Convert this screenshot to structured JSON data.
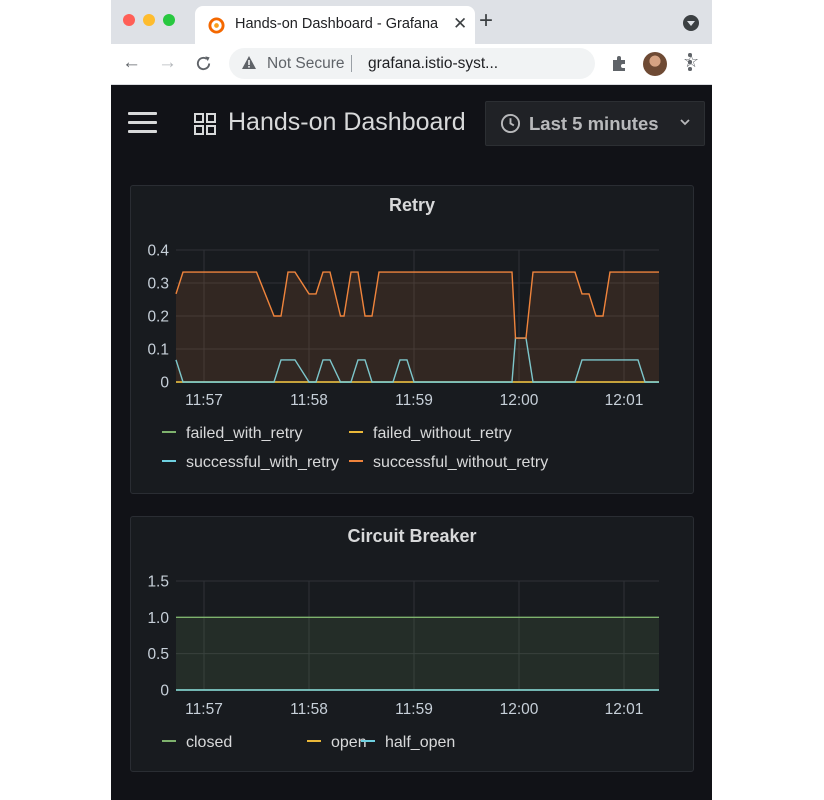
{
  "browser": {
    "tab_title": "Hands-on Dashboard - Grafana",
    "new_tab": "+",
    "close": "✕",
    "security_label": "Not Secure",
    "url": "grafana.istio-syst..."
  },
  "dashboard": {
    "title": "Hands-on Dashboard",
    "time_range": "Last 5 minutes"
  },
  "colors": {
    "failed_with_retry": "#7eb26d",
    "failed_without_retry": "#eab839",
    "successful_with_retry": "#6ed0e0",
    "successful_without_retry": "#ef843c",
    "closed": "#7eb26d",
    "open": "#eab839",
    "half_open": "#6ed0e0"
  },
  "panels": [
    {
      "title": "Retry",
      "chart_data": {
        "type": "line",
        "x": [
          "11:56:44",
          "11:56:48",
          "11:56:52",
          "11:57:00",
          "11:57:10",
          "11:57:20",
          "11:57:30",
          "11:57:40",
          "11:57:44",
          "11:57:48",
          "11:57:52",
          "11:58:00",
          "11:58:04",
          "11:58:08",
          "11:58:12",
          "11:58:18",
          "11:58:20",
          "11:58:24",
          "11:58:28",
          "11:58:32",
          "11:58:36",
          "11:58:40",
          "11:58:44",
          "11:58:48",
          "11:58:52",
          "11:58:56",
          "11:59:00",
          "11:59:04",
          "11:59:08",
          "11:59:12",
          "11:59:16",
          "11:59:20",
          "11:59:30",
          "11:59:40",
          "11:59:48",
          "11:59:56",
          "11:59:58",
          "12:00:04",
          "12:00:08",
          "12:00:14",
          "12:00:20",
          "12:00:28",
          "12:00:32",
          "12:00:36",
          "12:00:40",
          "12:00:44",
          "12:00:48",
          "12:00:52",
          "12:01:00",
          "12:01:04",
          "12:01:08",
          "12:01:12",
          "12:01:16",
          "12:01:20"
        ],
        "series": [
          {
            "name": "failed_with_retry",
            "values": [
              0,
              0,
              0,
              0,
              0,
              0,
              0,
              0,
              0,
              0,
              0,
              0,
              0,
              0,
              0,
              0,
              0,
              0,
              0,
              0,
              0,
              0,
              0,
              0,
              0,
              0,
              0,
              0,
              0,
              0,
              0,
              0,
              0,
              0,
              0,
              0,
              0,
              0,
              0,
              0,
              0,
              0,
              0,
              0,
              0,
              0,
              0,
              0,
              0,
              0,
              0,
              0,
              0,
              0
            ]
          },
          {
            "name": "failed_without_retry",
            "values": [
              0,
              0,
              0,
              0,
              0,
              0,
              0,
              0,
              0,
              0,
              0,
              0,
              0,
              0,
              0,
              0,
              0,
              0,
              0,
              0,
              0,
              0,
              0,
              0,
              0,
              0,
              0,
              0,
              0,
              0,
              0,
              0,
              0,
              0,
              0,
              0,
              0,
              0,
              0,
              0,
              0,
              0,
              0,
              0,
              0,
              0,
              0,
              0,
              0,
              0,
              0,
              0,
              0,
              0
            ]
          },
          {
            "name": "successful_with_retry",
            "values": [
              0.067,
              0,
              0,
              0,
              0,
              0,
              0,
              0,
              0.067,
              0.067,
              0.067,
              0,
              0,
              0.067,
              0.067,
              0,
              0,
              0,
              0.067,
              0.067,
              0,
              0,
              0,
              0,
              0.067,
              0.067,
              0,
              0,
              0,
              0,
              0,
              0,
              0,
              0,
              0,
              0,
              0.133,
              0.133,
              0,
              0,
              0,
              0,
              0,
              0.067,
              0.067,
              0.067,
              0.067,
              0.067,
              0.067,
              0.067,
              0.067,
              0,
              0,
              0
            ]
          },
          {
            "name": "successful_without_retry",
            "values": [
              0.267,
              0.333,
              0.333,
              0.333,
              0.333,
              0.333,
              0.333,
              0.2,
              0.2,
              0.333,
              0.333,
              0.267,
              0.267,
              0.333,
              0.333,
              0.2,
              0.2,
              0.333,
              0.333,
              0.2,
              0.2,
              0.333,
              0.333,
              0.333,
              0.333,
              0.333,
              0.333,
              0.333,
              0.333,
              0.333,
              0.333,
              0.333,
              0.333,
              0.333,
              0.333,
              0.333,
              0.133,
              0.133,
              0.333,
              0.333,
              0.333,
              0.333,
              0.333,
              0.267,
              0.267,
              0.2,
              0.2,
              0.333,
              0.333,
              0.333,
              0.333,
              0.333,
              0.333,
              0.333
            ]
          }
        ],
        "xticks": [
          "11:57",
          "11:58",
          "11:59",
          "12:00",
          "12:01"
        ],
        "yticks": [
          "0",
          "0.1",
          "0.2",
          "0.3",
          "0.4"
        ],
        "ylim": [
          0,
          0.4
        ],
        "grid": true,
        "legend_placement": "bottom",
        "filled_series": "successful_without_retry"
      },
      "legend_rows": [
        [
          "failed_with_retry",
          "failed_without_retry"
        ],
        [
          "successful_with_retry",
          "successful_without_retry"
        ]
      ]
    },
    {
      "title": "Circuit Breaker",
      "chart_data": {
        "type": "line",
        "x": [
          "11:56:44",
          "12:01:20"
        ],
        "series": [
          {
            "name": "closed",
            "values": [
              1,
              1
            ]
          },
          {
            "name": "open",
            "values": [
              0,
              0
            ]
          },
          {
            "name": "half_open",
            "values": [
              0,
              0
            ]
          }
        ],
        "xticks": [
          "11:57",
          "11:58",
          "11:59",
          "12:00",
          "12:01"
        ],
        "yticks": [
          "0",
          "0.5",
          "1.0",
          "1.5"
        ],
        "ylim": [
          0,
          1.5
        ],
        "grid": true,
        "legend_placement": "bottom",
        "filled_series": "closed"
      },
      "legend_rows": [
        [
          "closed",
          "open",
          "half_open"
        ]
      ]
    }
  ]
}
